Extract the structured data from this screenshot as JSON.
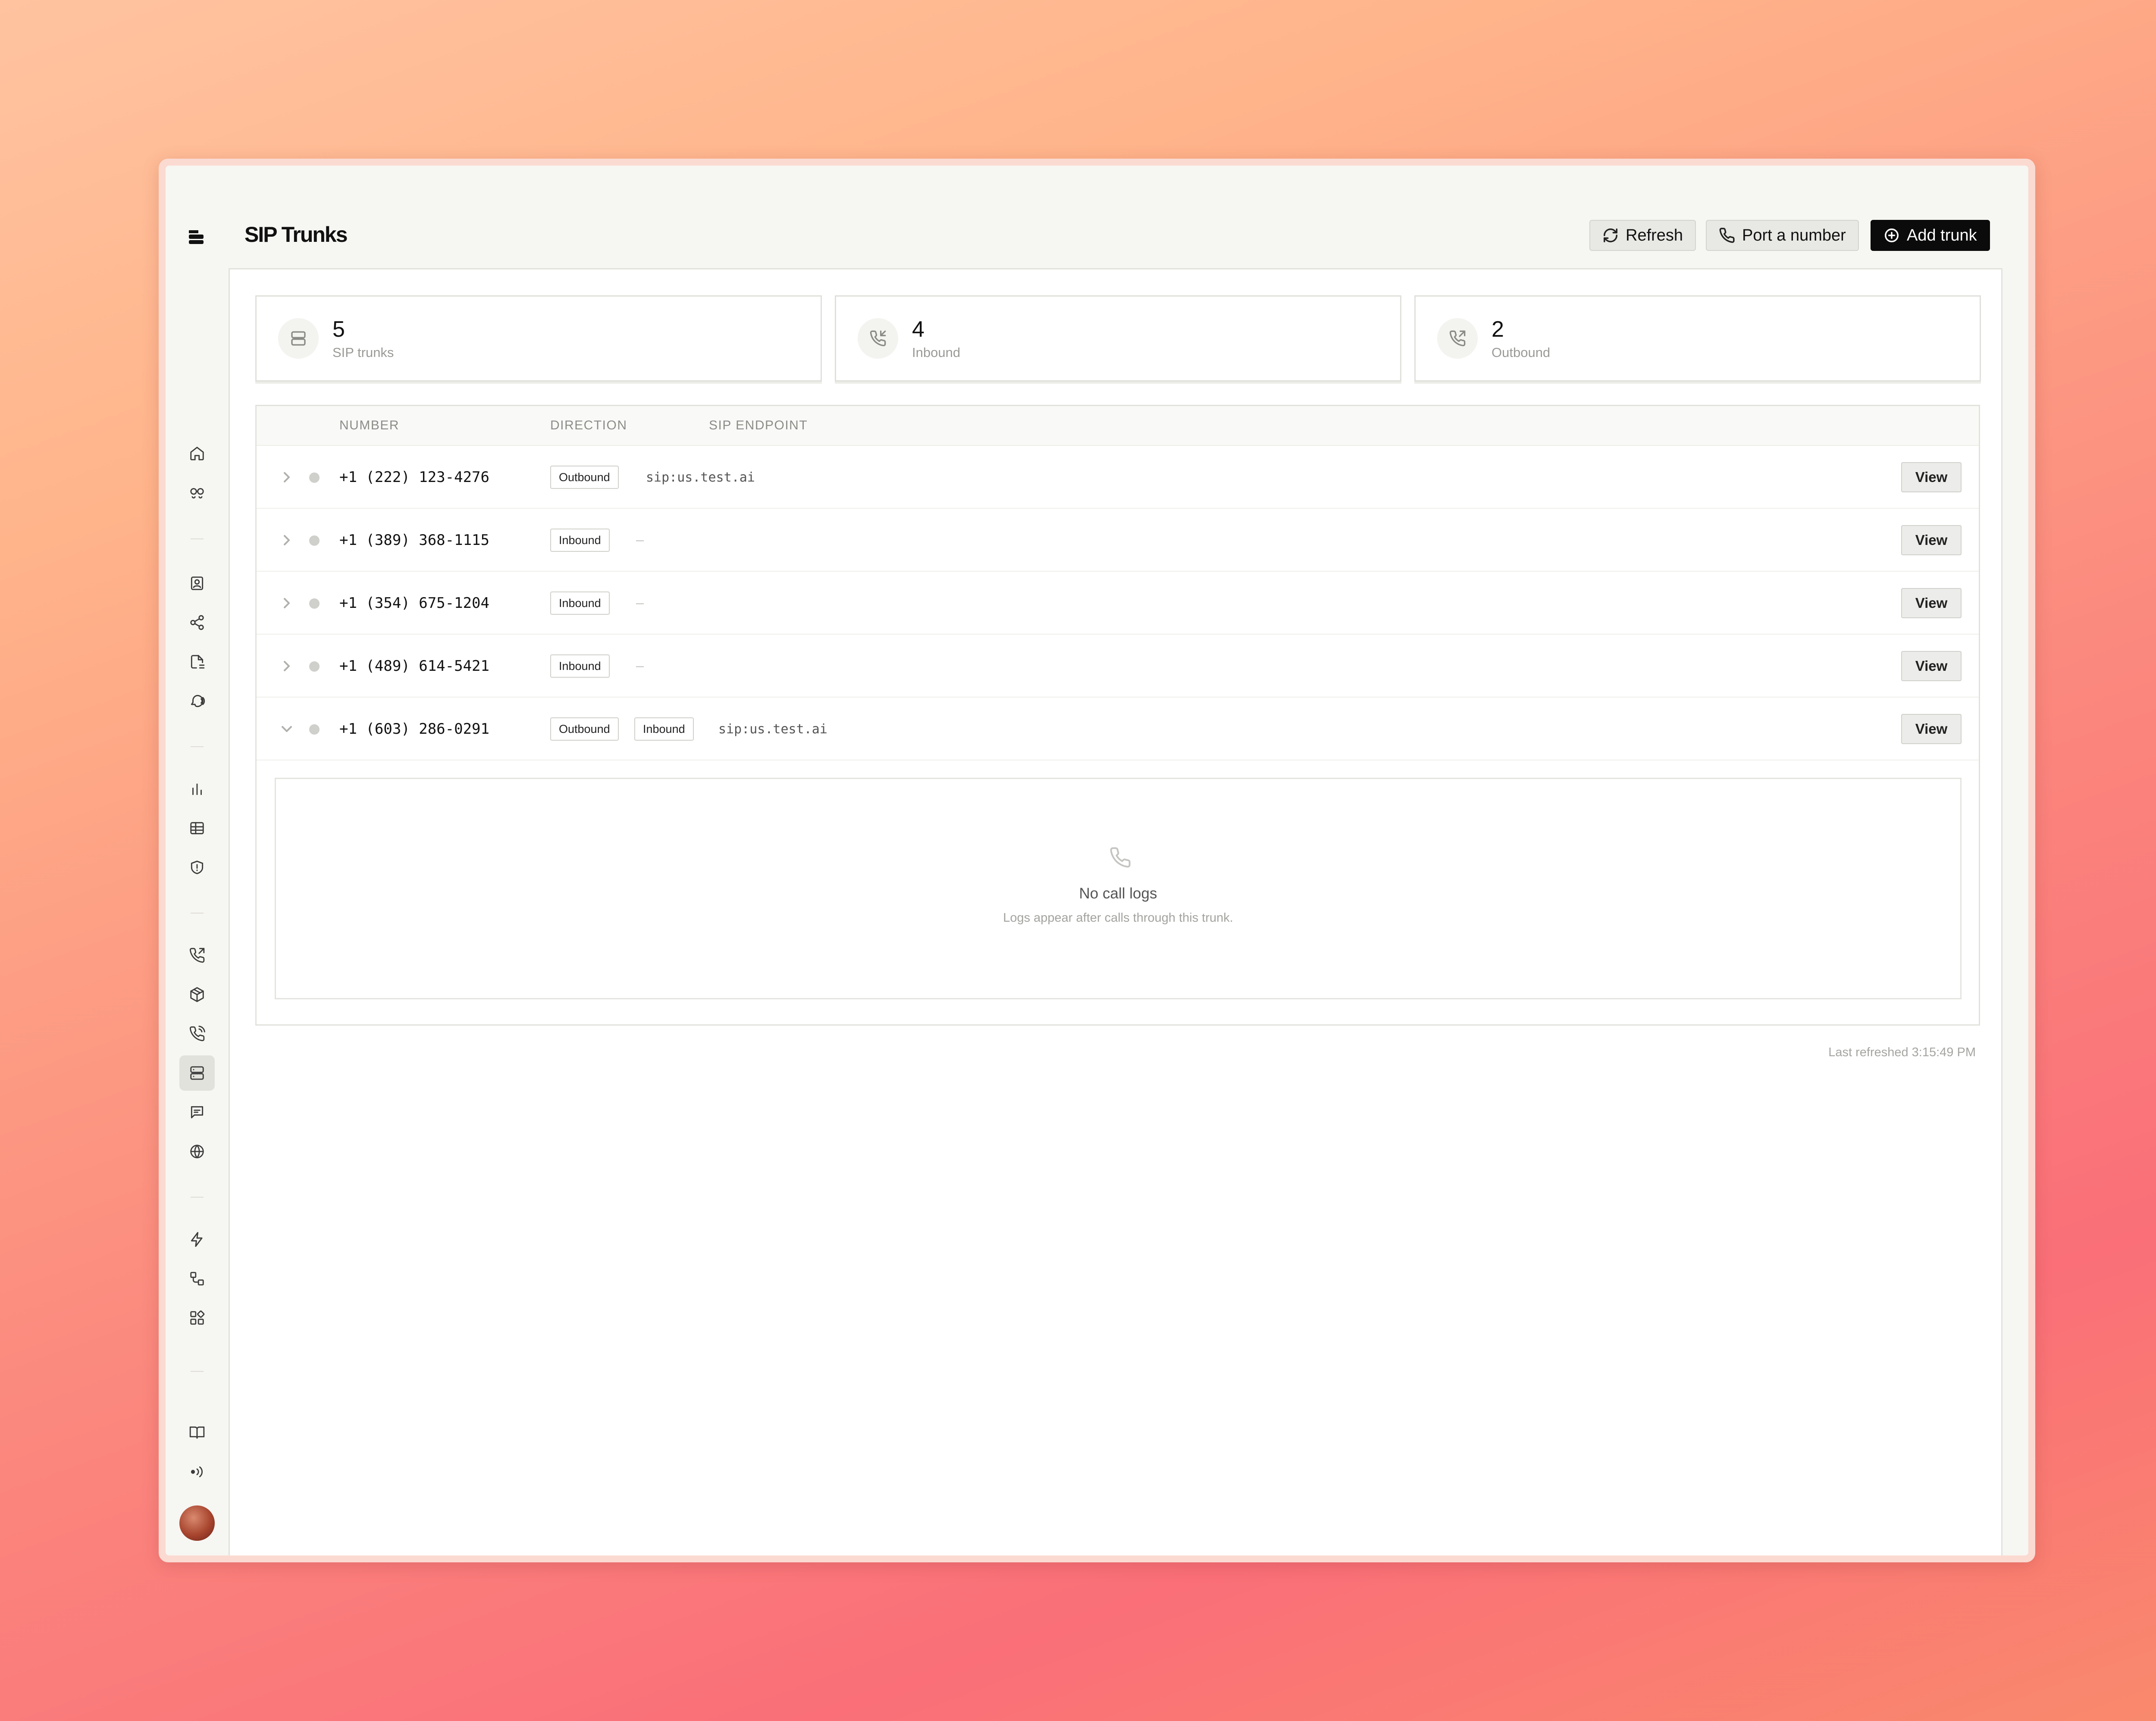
{
  "header": {
    "title": "SIP Trunks",
    "refresh_label": "Refresh",
    "port_label": "Port a number",
    "add_label": "Add trunk"
  },
  "sidebar": {
    "top_icons": [
      "home-icon",
      "agents-icon"
    ],
    "group1_icons": [
      "contacts-icon",
      "share-icon",
      "document-scan-icon",
      "voice-icon"
    ],
    "group2_icons": [
      "analytics-icon",
      "table-icon",
      "shield-icon"
    ],
    "group3_icons": [
      "phone-outgoing-icon",
      "package-icon",
      "phone-call-icon",
      "sip-trunk-icon",
      "message-icon",
      "globe-icon"
    ],
    "group4_icons": [
      "lightning-icon",
      "workflow-icon",
      "integrations-icon"
    ],
    "bottom_icons": [
      "docs-icon",
      "broadcast-icon"
    ],
    "active_item": "sip-trunk-icon"
  },
  "stats": [
    {
      "value": "5",
      "label": "SIP trunks",
      "icon": "server-icon"
    },
    {
      "value": "4",
      "label": "Inbound",
      "icon": "phone-incoming-icon"
    },
    {
      "value": "2",
      "label": "Outbound",
      "icon": "phone-outgoing-icon"
    }
  ],
  "table": {
    "columns": [
      "NUMBER",
      "DIRECTION",
      "SIP ENDPOINT"
    ],
    "rows": [
      {
        "number": "+1 (222) 123-4276",
        "directions": [
          "Outbound"
        ],
        "endpoint": "sip:us.test.ai",
        "action": "View",
        "expanded": false
      },
      {
        "number": "+1 (389) 368-1115",
        "directions": [
          "Inbound"
        ],
        "endpoint": "—",
        "action": "View",
        "expanded": false
      },
      {
        "number": "+1 (354) 675-1204",
        "directions": [
          "Inbound"
        ],
        "endpoint": "—",
        "action": "View",
        "expanded": false
      },
      {
        "number": "+1 (489) 614-5421",
        "directions": [
          "Inbound"
        ],
        "endpoint": "—",
        "action": "View",
        "expanded": false
      },
      {
        "number": "+1 (603) 286-0291",
        "directions": [
          "Outbound",
          "Inbound"
        ],
        "endpoint": "sip:us.test.ai",
        "action": "View",
        "expanded": true
      }
    ],
    "empty_state": {
      "title": "No call logs",
      "subtitle": "Logs appear after calls through this trunk."
    }
  },
  "footer": {
    "last_refreshed": "Last refreshed 3:15:49 PM"
  }
}
